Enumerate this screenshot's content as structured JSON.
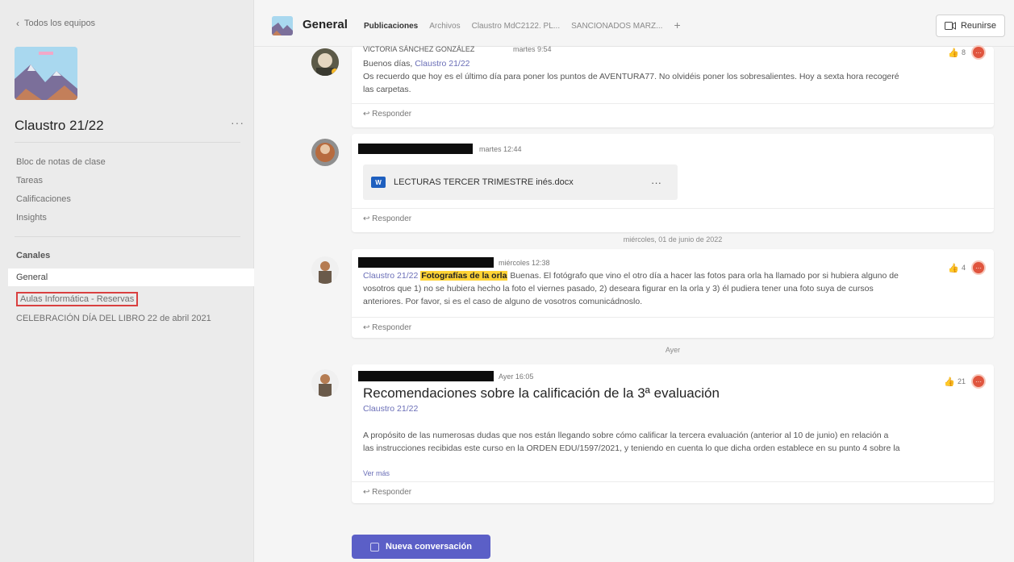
{
  "sidebar": {
    "back_label": "Todos los equipos",
    "team_name": "Claustro 21/22",
    "more_label": "···",
    "tabs": [
      "Bloc de notas de clase",
      "Tareas",
      "Calificaciones",
      "Insights"
    ],
    "channels_heading": "Canales",
    "channels": [
      "General",
      "Aulas Informática - Reservas",
      "CELEBRACIÓN DÍA DEL LIBRO 22 de abril 2021"
    ]
  },
  "header": {
    "channel_title": "General",
    "tabs": [
      "Publicaciones",
      "Archivos",
      "Claustro MdC2122. PL...",
      "SANCIONADOS MARZ..."
    ],
    "add_tab": "+",
    "meet_label": "Reunirse"
  },
  "messages": {
    "m1": {
      "author": "VICTORIA SÁNCHEZ GONZÁLEZ",
      "time": "martes 9:54",
      "line1_prefix": "Buenos días, ",
      "mention": "Claustro 21/22",
      "line2": "Os recuerdo que hoy es el último día para poner los puntos de AVENTURA77. No olvidéis poner los sobresalientes. Hoy a sexta hora recogeré",
      "line3": "las carpetas.",
      "reaction_count": "8",
      "reply": "Responder"
    },
    "m2": {
      "time": "martes 12:44",
      "file_name": "LECTURAS TERCER TRIMESTRE inés.docx",
      "file_more": "···",
      "reply": "Responder"
    },
    "date1": "miércoles, 01 de junio de 2022",
    "m3": {
      "time": "miércoles 12:38",
      "mention": "Claustro 21/22",
      "highlight": "Fotografías de la orla",
      "line1_rest": " Buenas. El fotógrafo que vino el otro día a hacer las fotos para orla ha llamado por si hubiera alguno de",
      "line2": "vosotros que 1) no se hubiera hecho la foto el viernes pasado, 2) deseara figurar en la orla y 3) él pudiera tener una foto suya de cursos",
      "line3": "anteriores. Por favor, si es el caso de alguno de vosotros comunicádnoslo.",
      "reaction_count": "4",
      "reply": "Responder"
    },
    "date2": "Ayer",
    "m4": {
      "time": "Ayer 16:05",
      "title": "Recomendaciones sobre la calificación de la 3ª evaluación",
      "mention": "Claustro 21/22",
      "line1": "A propósito de las numerosas dudas que nos están llegando sobre cómo calificar la tercera evaluación (anterior al 10 de junio) en relación a",
      "line2": "las instrucciones recibidas este curso en la ORDEN EDU/1597/2021, y teniendo en cuenta lo que dicha orden establece en su punto 4 sobre la",
      "see_more": "Ver más",
      "reaction_count": "21",
      "reply": "Responder"
    }
  },
  "new_conversation": "Nueva conversación",
  "colors": {
    "accent": "#5b5fc7",
    "mention": "#6a6eb7",
    "highlight": "#ffd335",
    "channel_box": "#d94040"
  }
}
